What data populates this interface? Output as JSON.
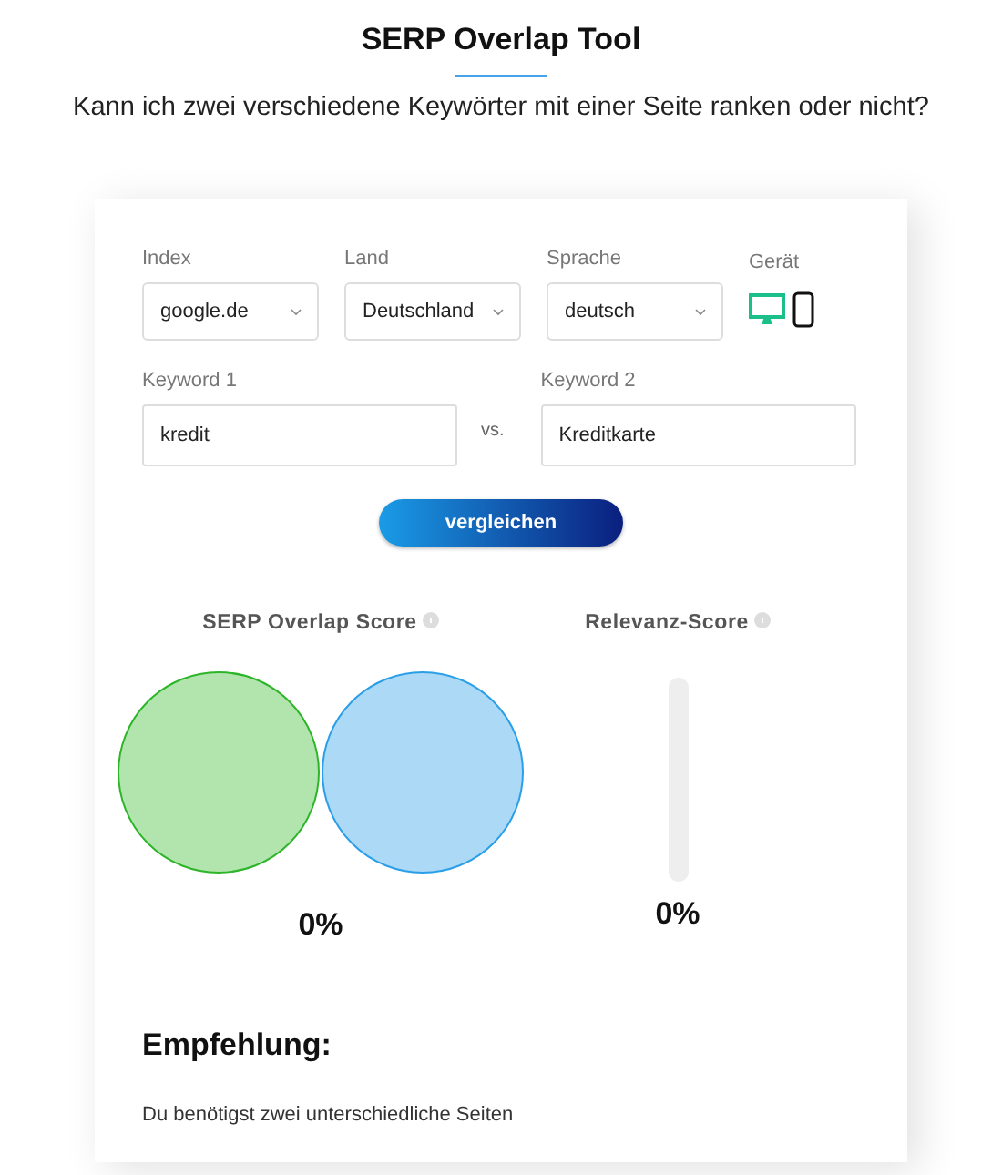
{
  "header": {
    "title": "SERP Overlap Tool",
    "subtitle": "Kann ich zwei verschiedene Keywörter mit einer Seite ranken oder nicht?"
  },
  "selects": [
    {
      "label": "Index",
      "value": "google.de"
    },
    {
      "label": "Land",
      "value": "Deutschland"
    },
    {
      "label": "Sprache",
      "value": "deutsch"
    }
  ],
  "device": {
    "label": "Gerät",
    "options": [
      {
        "kind": "desktop",
        "selected": true
      },
      {
        "kind": "mobile",
        "selected": false
      }
    ]
  },
  "keywords": [
    {
      "label": "Keyword 1",
      "value": "kredit"
    },
    {
      "label": "Keyword 2",
      "value": "Kreditkarte"
    }
  ],
  "versus": "vs.",
  "compare_button": "vergleichen",
  "overlap_score": {
    "title": "SERP Overlap Score",
    "value": "0%"
  },
  "relevance_score": {
    "title": "Relevanz-Score",
    "level": 0,
    "value": "0%"
  },
  "recommendation": {
    "title": "Empfehlung:",
    "text": "Du benötigst zwei unterschiedliche Seiten"
  }
}
